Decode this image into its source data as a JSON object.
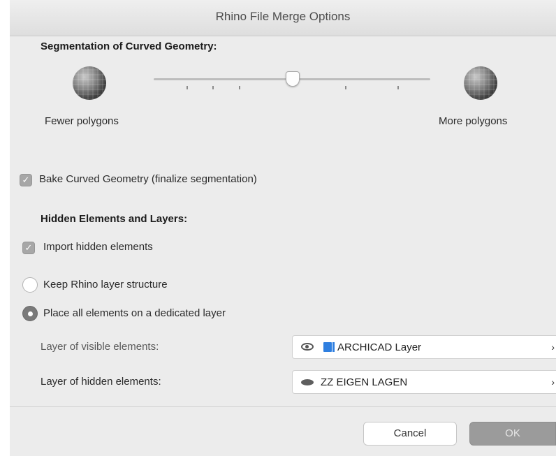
{
  "window": {
    "title": "Rhino File Merge Options"
  },
  "segmentation": {
    "heading": "Segmentation of Curved Geometry:",
    "fewer_label": "Fewer polygons",
    "more_label": "More polygons",
    "slider_level_fraction": 0.5
  },
  "bake": {
    "label": "Bake Curved Geometry (finalize segmentation)",
    "checked": true
  },
  "hidden": {
    "heading": "Hidden Elements and Layers:",
    "import_label": "Import hidden elements",
    "import_checked": true,
    "keep_label": "Keep Rhino layer structure",
    "place_label": "Place all elements on a dedicated layer",
    "selected_option": "place"
  },
  "layers": {
    "visible_label": "Layer of visible elements:",
    "visible_value": "ARCHICAD Layer",
    "hidden_label": "Layer of hidden elements:",
    "hidden_value": "ZZ EIGEN LAGEN"
  },
  "buttons": {
    "cancel": "Cancel",
    "ok": "OK"
  },
  "icons": {
    "checkmark": "✓",
    "chevron": "›"
  },
  "colors": {
    "accent_layer_icon": "#2f7fe0",
    "ok_button": "#9b9b9b"
  }
}
